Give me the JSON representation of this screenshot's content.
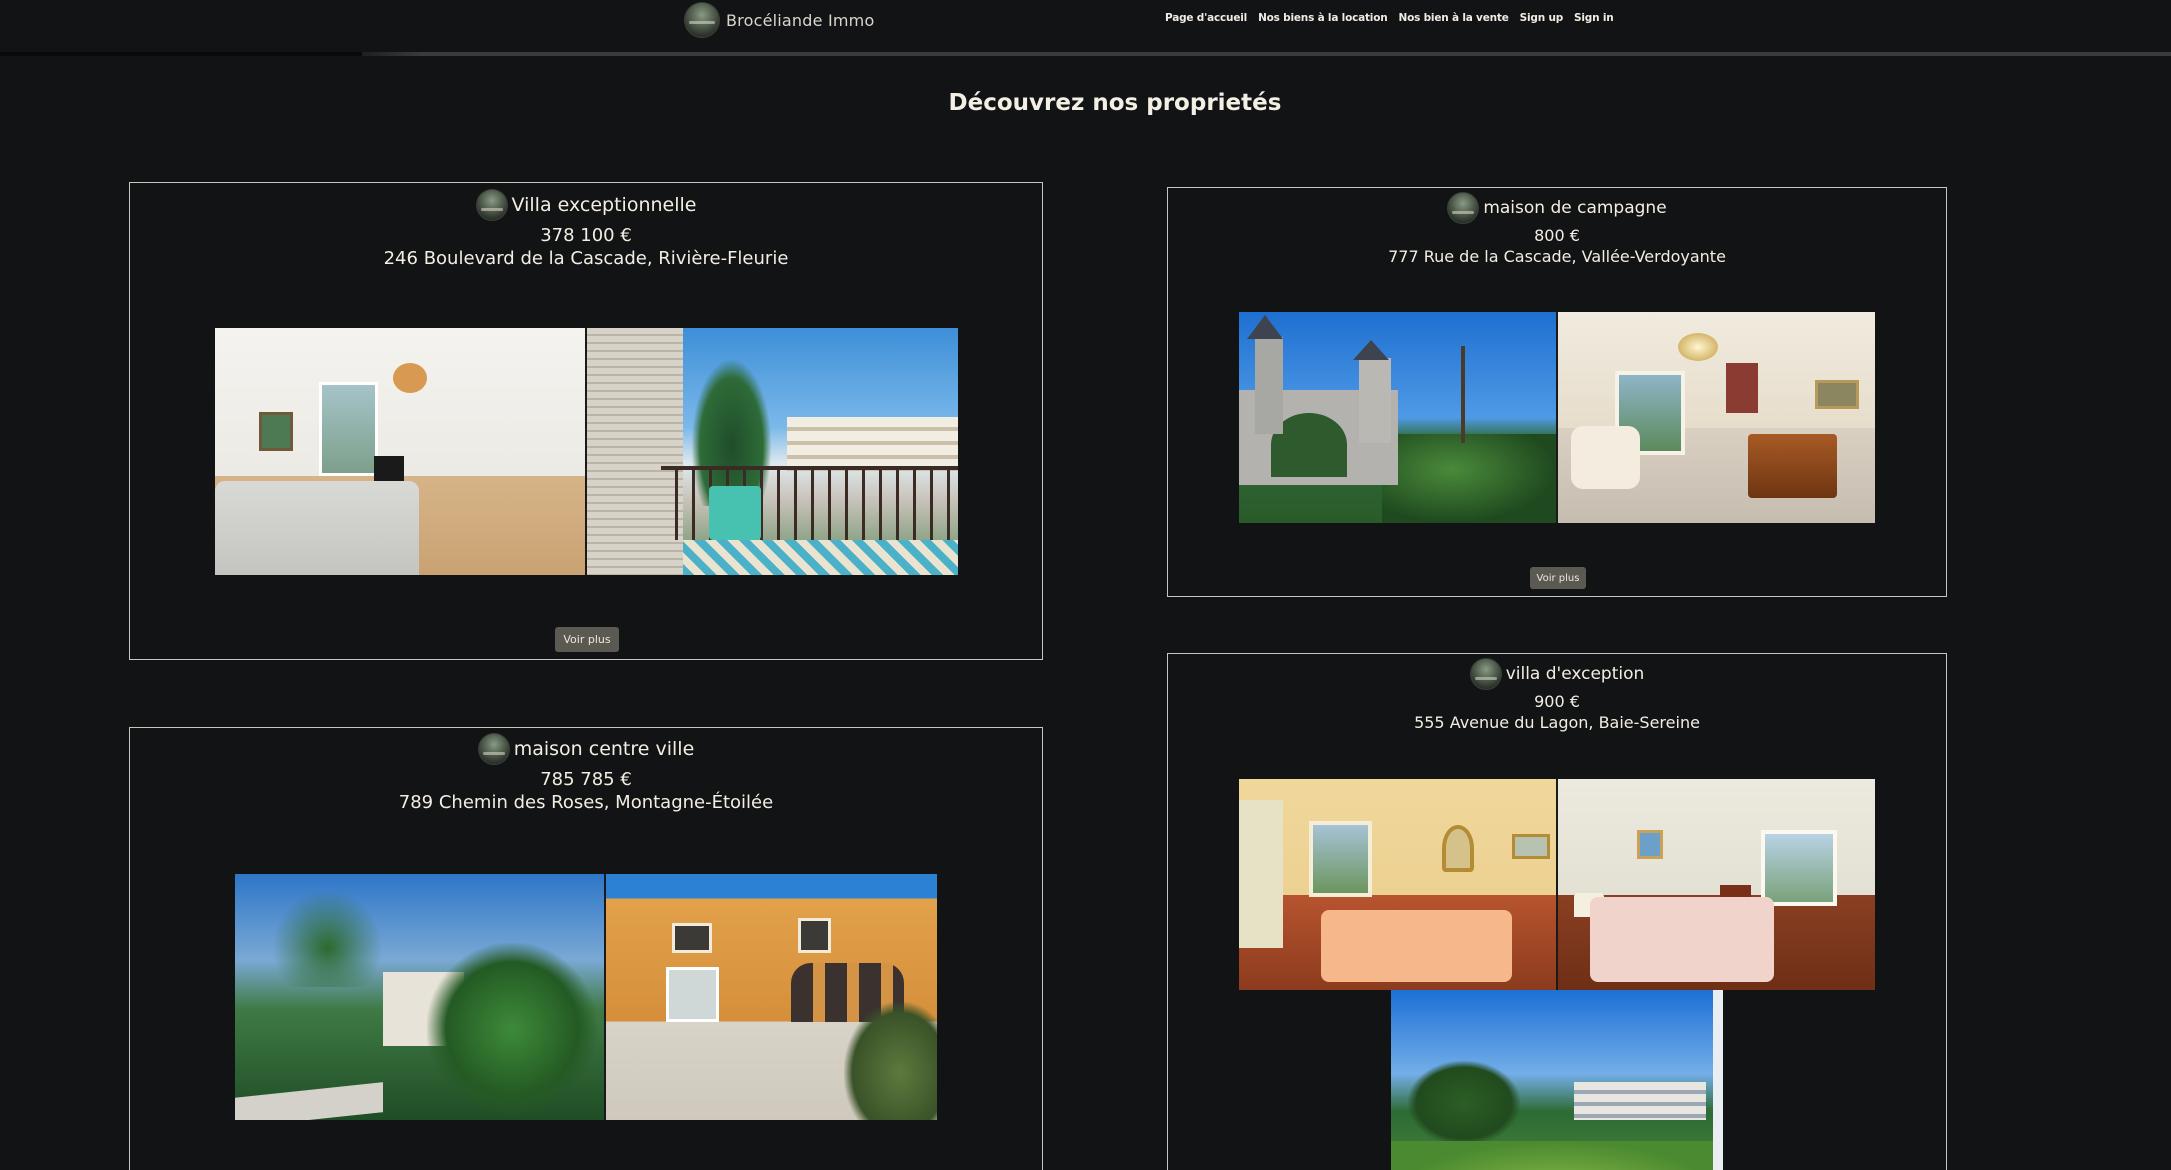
{
  "header": {
    "brand_name": "Brocéliande Immo",
    "nav": [
      {
        "label": "Page d'accueil"
      },
      {
        "label": "Nos biens à la location"
      },
      {
        "label": "Nos bien à la vente"
      },
      {
        "label": "Sign up"
      },
      {
        "label": "Sign in"
      }
    ]
  },
  "page": {
    "title": "Découvrez nos proprietés"
  },
  "listings": [
    {
      "title": "Villa exceptionnelle",
      "price": "378 100 €",
      "address": "246 Boulevard de la Cascade, Rivière-Fleurie",
      "button_label": "Voir plus"
    },
    {
      "title": "maison de campagne",
      "price": "800 €",
      "address": "777 Rue de la Cascade, Vallée-Verdoyante",
      "button_label": "Voir plus"
    },
    {
      "title": "maison centre ville",
      "price": "785 785 €",
      "address": "789 Chemin des Roses, Montagne-Étoilée"
    },
    {
      "title": "villa d'exception",
      "price": "900 €",
      "address": "555 Avenue du Lagon, Baie-Sereine"
    }
  ],
  "colors": {
    "background": "#121314",
    "text": "#f1ede2",
    "card_border": "#c9c6bd",
    "button_bg": "#5b5a52"
  }
}
